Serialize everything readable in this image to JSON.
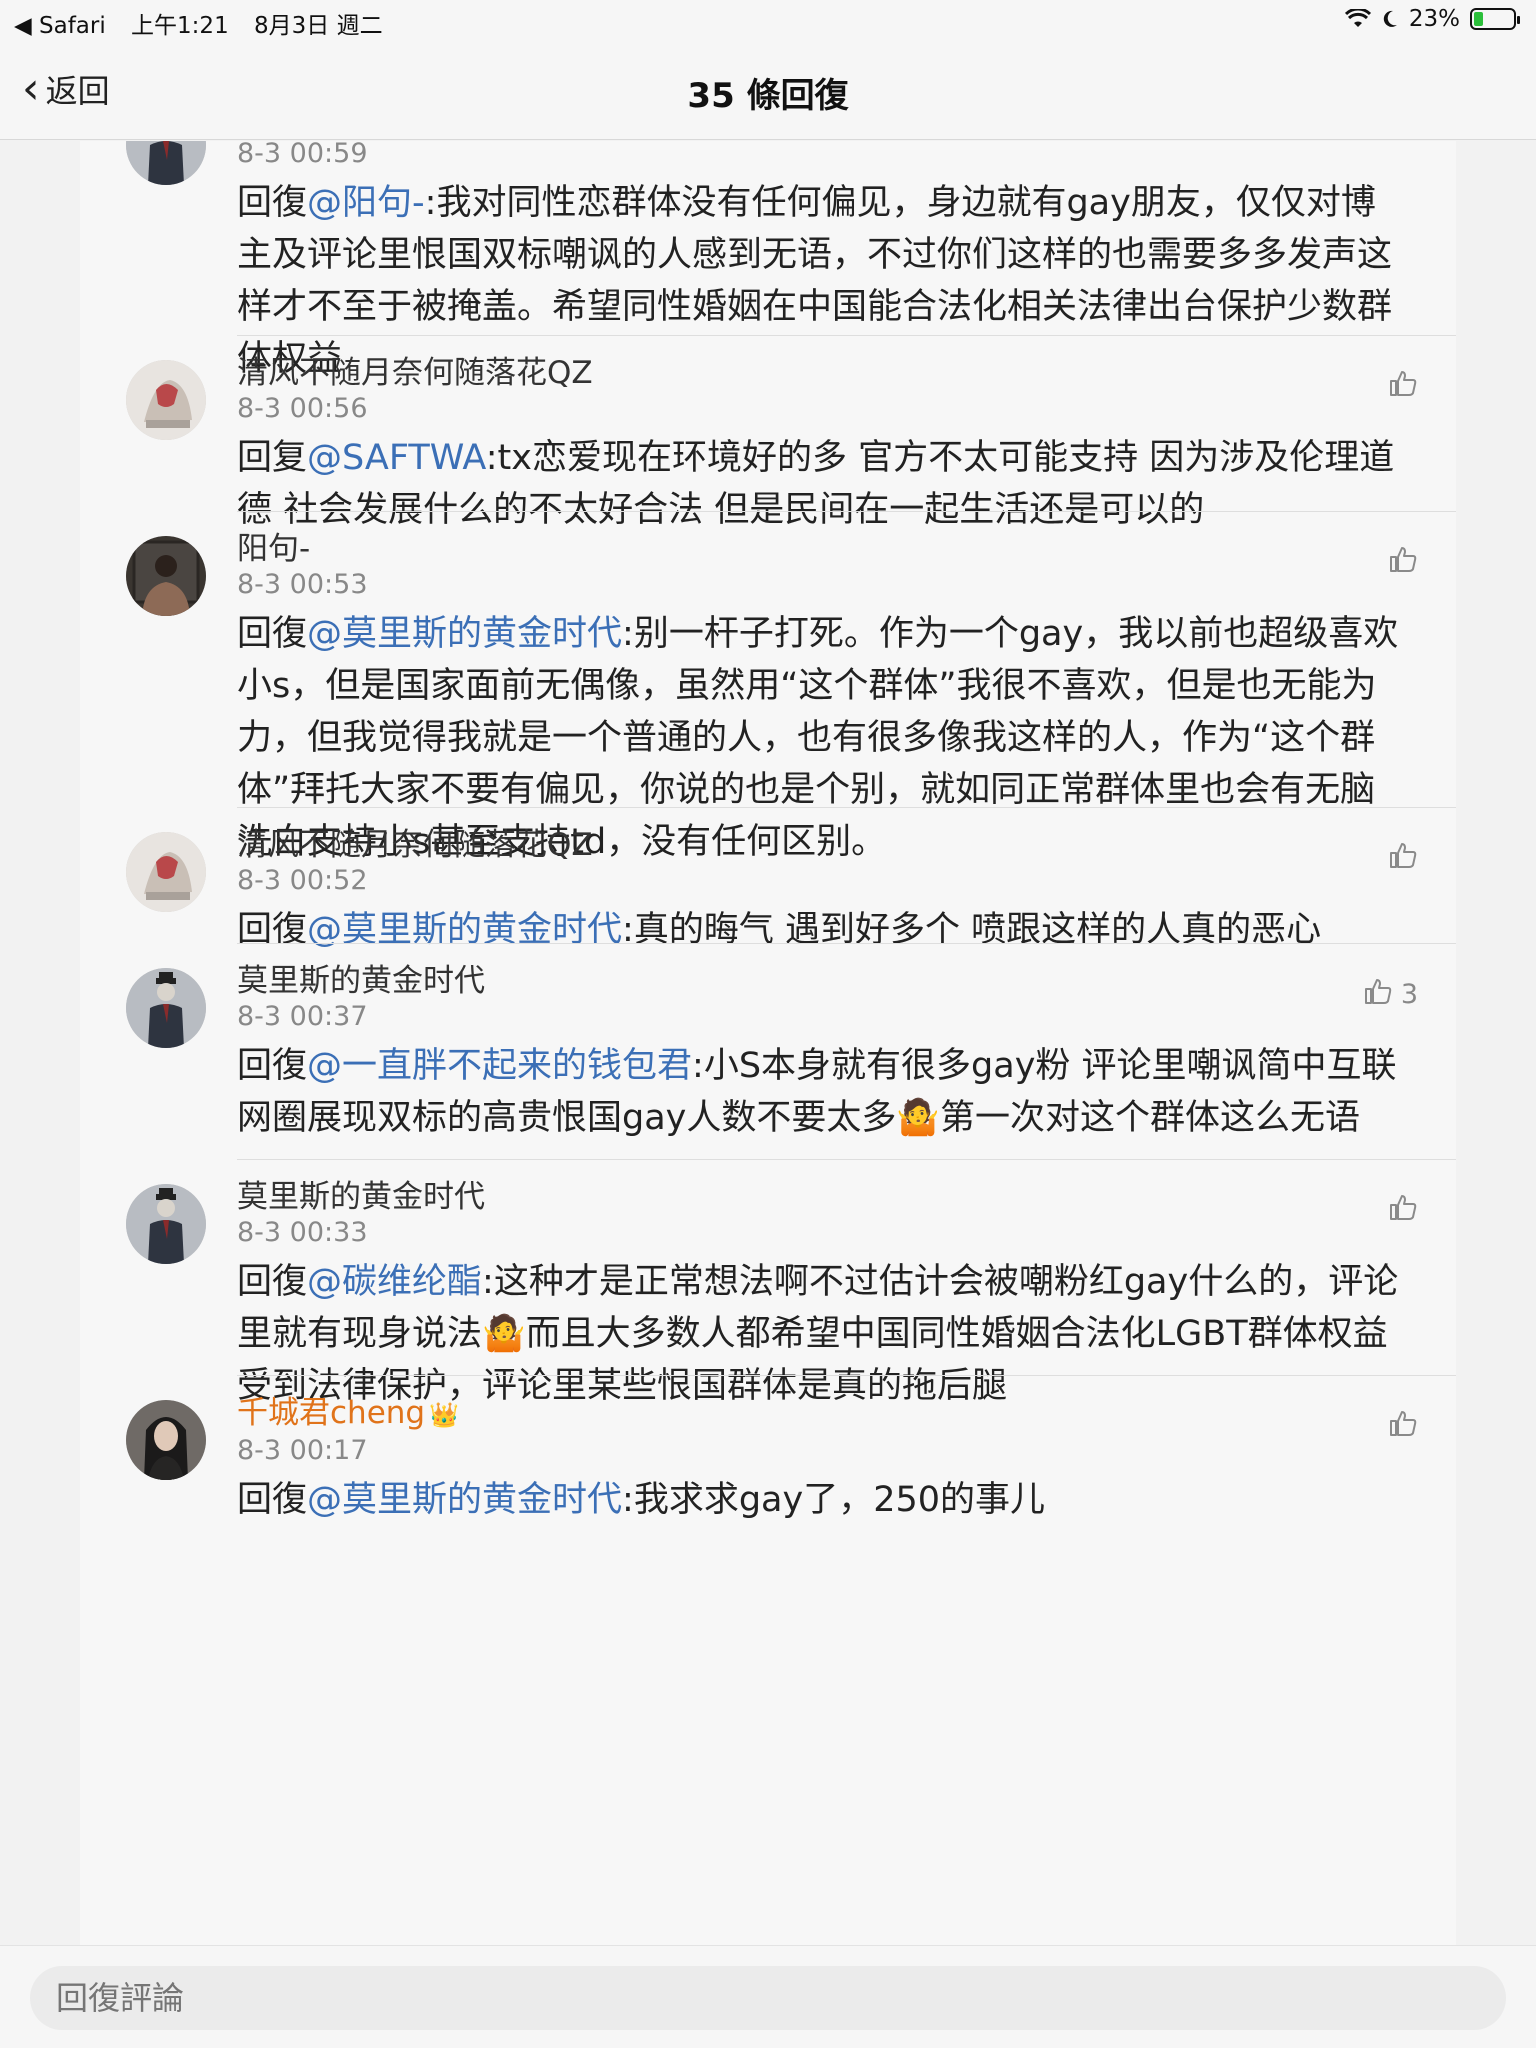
{
  "status_bar": {
    "app": "◀ Safari",
    "time": "上午1:21",
    "date": "8月3日 週二",
    "battery": "23%",
    "battery_level": 0.23
  },
  "nav": {
    "back_label": "返回",
    "title": "35 條回復"
  },
  "comments": [
    {
      "name": "",
      "time": "8-3 00:59",
      "reply_prefix": "回復",
      "mention": "@阳句-",
      "text": ":我对同性恋群体没有任何偏见，身边就有gay朋友，仅仅对博主及评论里恨国双标嘲讽的人感到无语，不过你们这样的也需要多多发声这样才不至于被掩盖。希望同性婚姻在中国能合法化相关法律出台保护少数群体权益",
      "likes": ""
    },
    {
      "name": "清风不随月奈何随落花QZ",
      "time": "8-3 00:56",
      "reply_prefix": "回复",
      "mention": "@SAFTWA",
      "text": ":tx恋爱现在环境好的多 官方不太可能支持 因为涉及伦理道德 社会发展什么的不太好合法 但是民间在一起生活还是可以的",
      "likes": ""
    },
    {
      "name": "阳句-",
      "time": "8-3 00:53",
      "reply_prefix": "回復",
      "mention": "@莫里斯的黄金时代",
      "text": ":别一杆子打死。作为一个gay，我以前也超级喜欢小s，但是国家面前无偶像，虽然用“这个群体”我很不喜欢，但是也无能为力，但我觉得我就是一个普通的人，也有很多像我这样的人，作为“这个群体”拜托大家不要有偏见，你说的也是个别，就如同正常群体里也会有无脑洗白支持小s甚至支持td，没有任何区别。",
      "likes": ""
    },
    {
      "name": "清风不随月奈何随落花QZ",
      "time": "8-3 00:52",
      "reply_prefix": "回復",
      "mention": "@莫里斯的黄金时代",
      "text": ":真的晦气 遇到好多个 喷跟这样的人真的恶心",
      "likes": ""
    },
    {
      "name": "莫里斯的黄金时代",
      "time": "8-3 00:37",
      "reply_prefix": "回復",
      "mention": "@一直胖不起来的钱包君",
      "text": ":小S本身就有很多gay粉 评论里嘲讽简中互联网圈展现双标的高贵恨国gay人数不要太多🤷第一次对这个群体这么无语",
      "likes": "3"
    },
    {
      "name": "莫里斯的黄金时代",
      "time": "8-3 00:33",
      "reply_prefix": "回復",
      "mention": "@碳维纶酯",
      "text": ":这种才是正常想法啊不过估计会被嘲粉红gay什么的，评论里就有现身说法🤷而且大多数人都希望中国同性婚姻合法化LGBT群体权益受到法律保护，评论里某些恨国群体是真的拖后腿",
      "likes": ""
    },
    {
      "name": "千城君cheng",
      "badge": "👑",
      "time": "8-3 00:17",
      "reply_prefix": "回復",
      "mention": "@莫里斯的黄金时代",
      "text": ":我求求gay了，250的事儿",
      "likes": ""
    }
  ],
  "reply_bar": {
    "placeholder": "回復評論"
  }
}
